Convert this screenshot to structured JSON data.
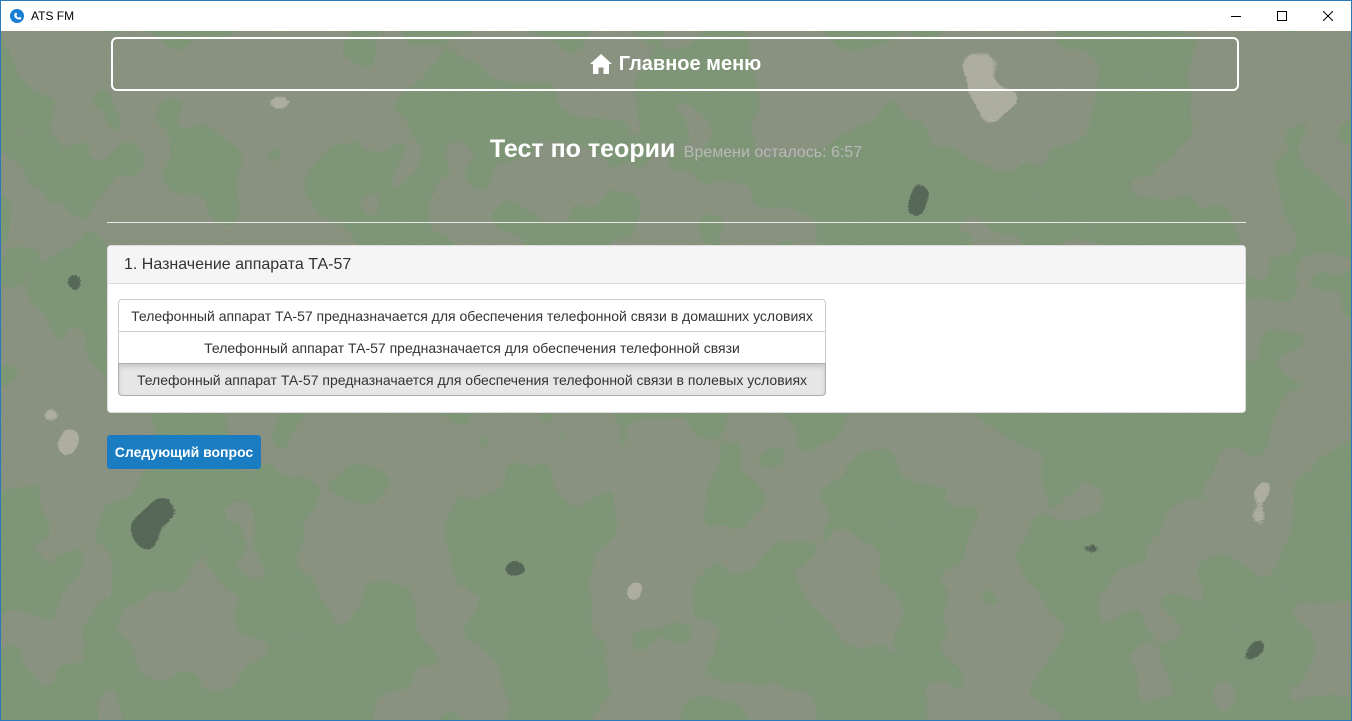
{
  "window": {
    "title": "ATS FM"
  },
  "nav": {
    "home_label": "Главное меню"
  },
  "test": {
    "title": "Тест по теории",
    "timer": "Времени осталось: 6:57",
    "question": {
      "text": "1. Назначение аппарата ТА-57",
      "answers": [
        "Телефонный аппарат ТА-57 предназначается для обеспечения телефонной связи в домашних условиях",
        "Телефонный аппарат ТА-57 предназначается для обеспечения телефонной связи",
        "Телефонный аппарат ТА-57 предназначается для обеспечения телефонной связи в полевых условиях"
      ],
      "selected_index": 2
    },
    "next_label": "Следующий вопрос"
  },
  "colors": {
    "accent": "#1a7cc1",
    "camo_base": "#4a5540",
    "camo_light": "#7a7d68",
    "camo_dark": "#1e2a1c",
    "camo_green": "#3d5a37"
  },
  "icons": {
    "app": "phone-icon",
    "home": "home-icon"
  }
}
